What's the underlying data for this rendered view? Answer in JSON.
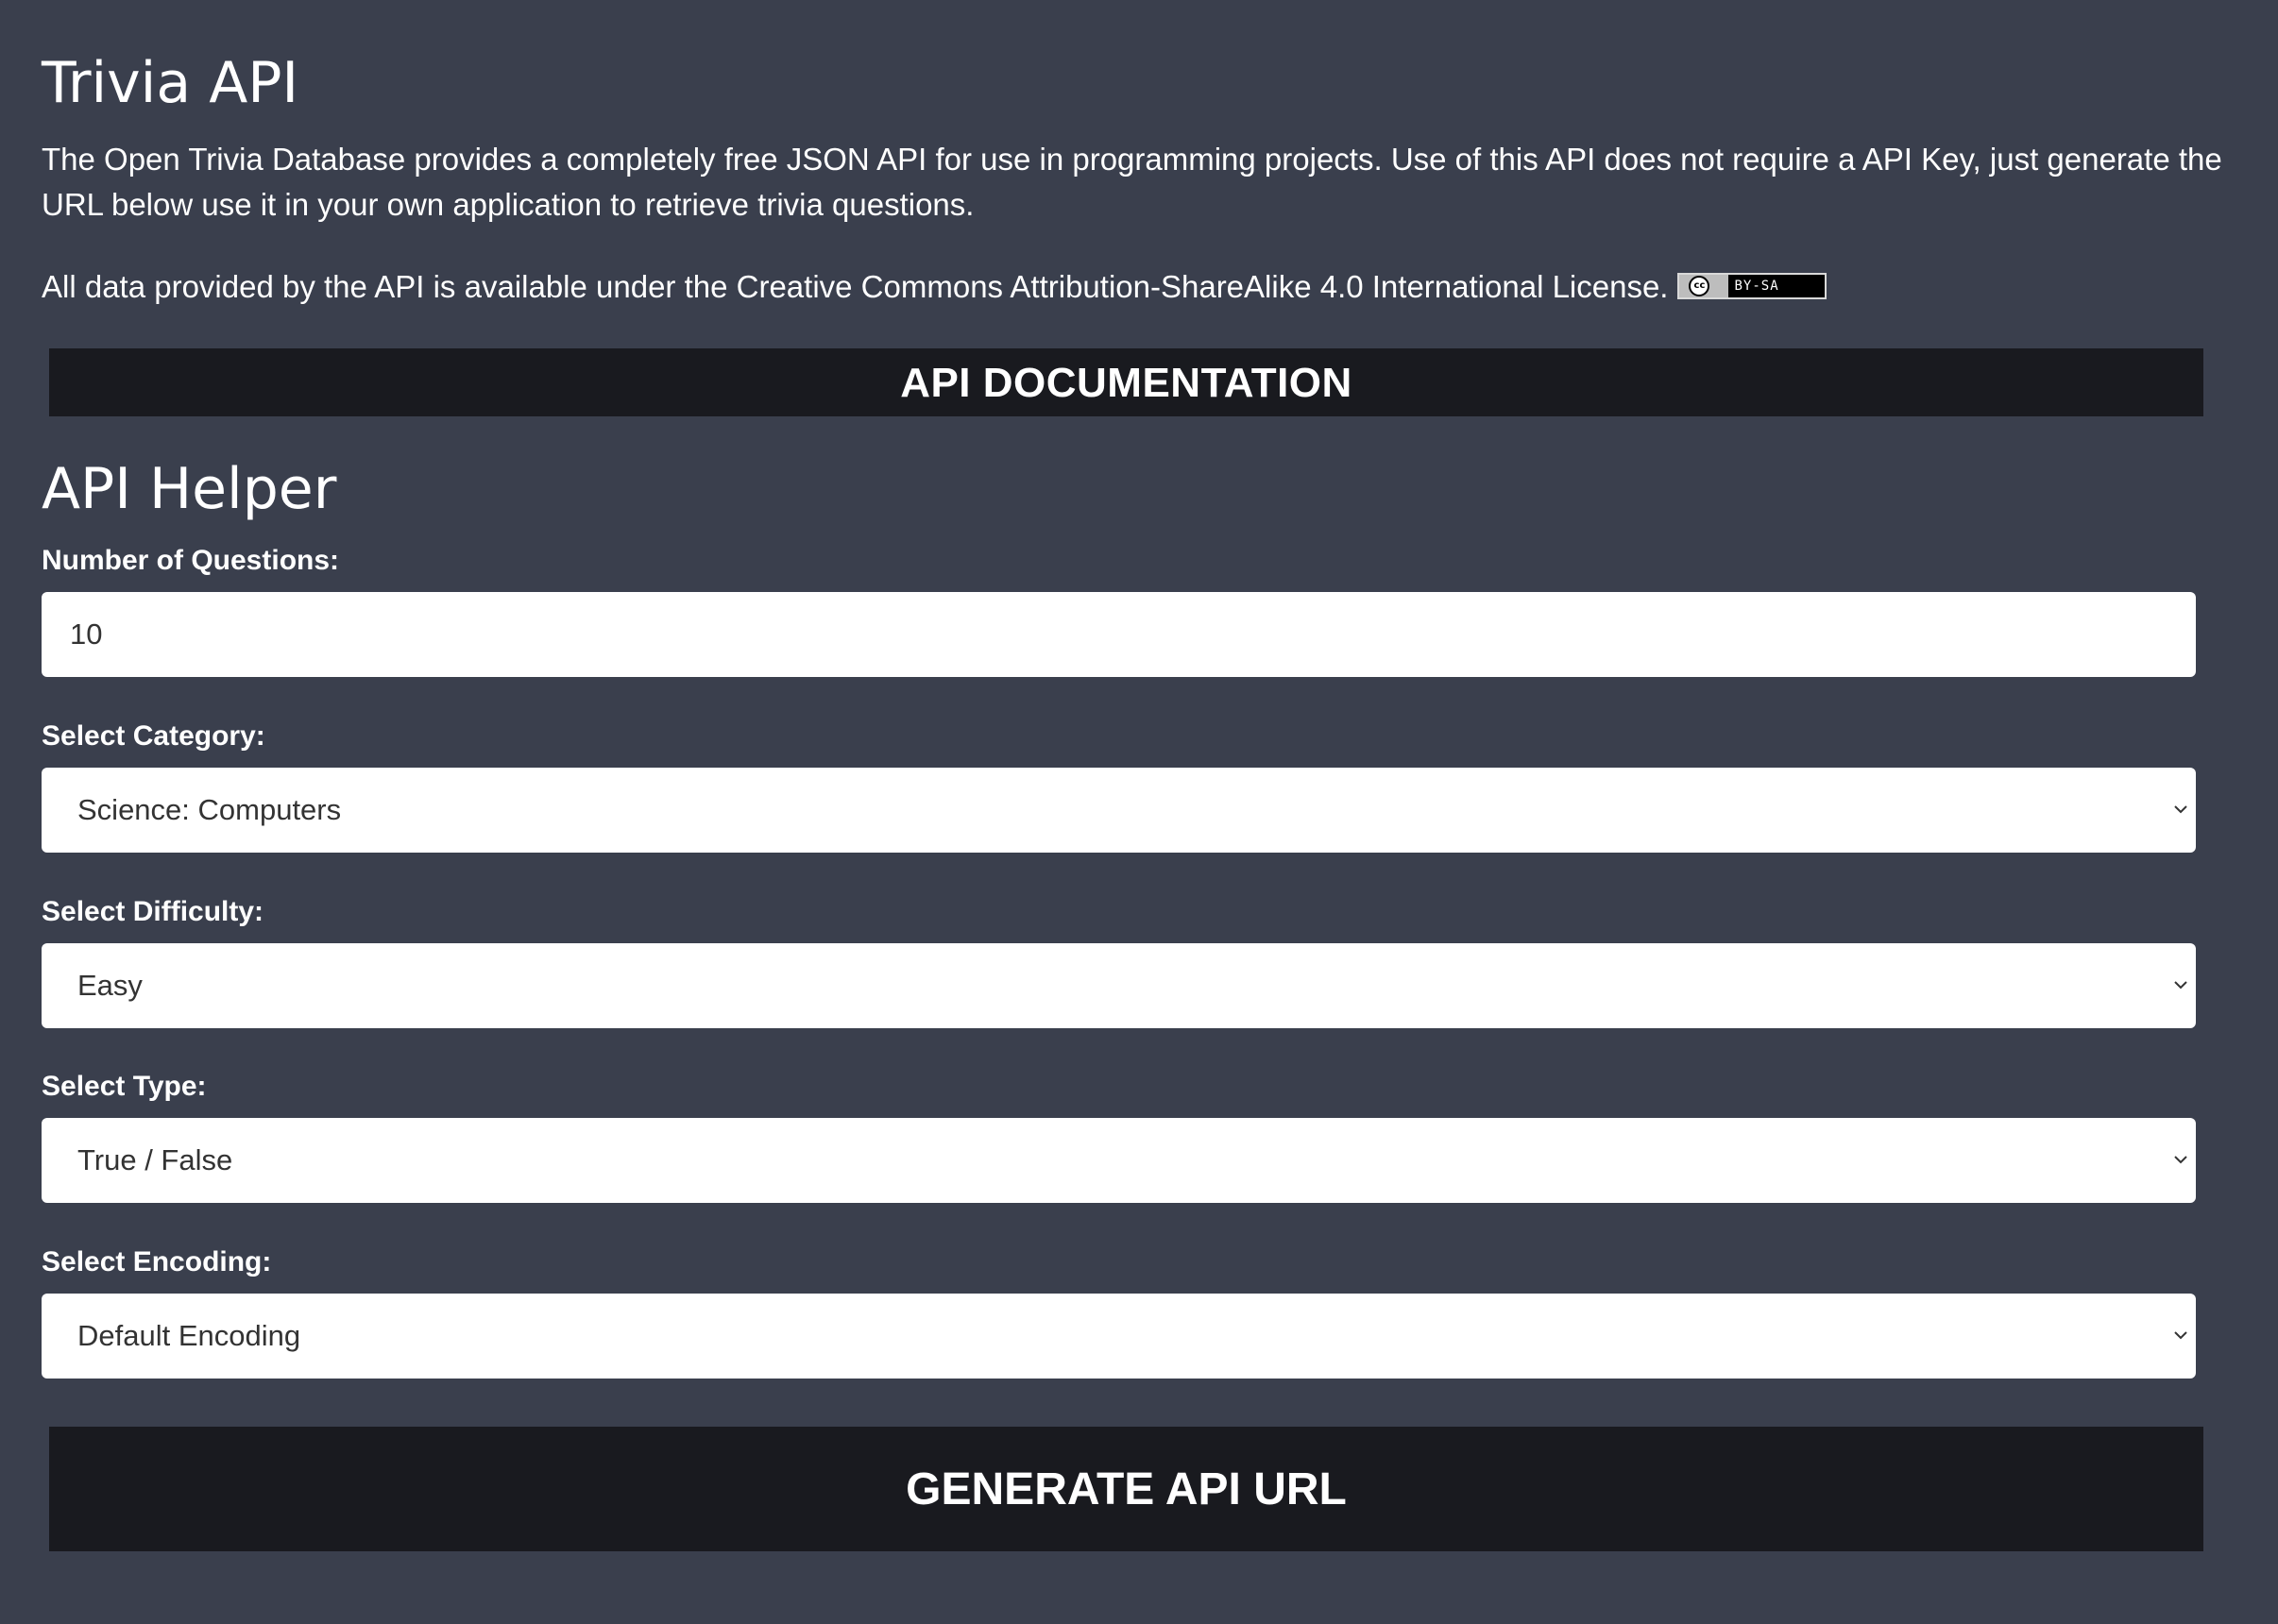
{
  "header": {
    "title": "Trivia API",
    "intro": "The Open Trivia Database provides a completely free JSON API for use in programming projects. Use of this API does not require a API Key, just generate the URL below use it in your own application to retrieve trivia questions.",
    "license_text": "All data provided by the API is available under the Creative Commons Attribution-ShareAlike 4.0 International License.",
    "license_badge": {
      "symbol": "cc",
      "label": "BY-SA"
    }
  },
  "documentation_button": {
    "label": "API DOCUMENTATION"
  },
  "helper": {
    "title": "API Helper",
    "fields": {
      "questions": {
        "label": "Number of Questions:",
        "value": "10"
      },
      "category": {
        "label": "Select Category:",
        "selected": "Science: Computers"
      },
      "difficulty": {
        "label": "Select Difficulty:",
        "selected": "Easy"
      },
      "type": {
        "label": "Select Type:",
        "selected": "True / False"
      },
      "encoding": {
        "label": "Select Encoding:",
        "selected": "Default Encoding"
      }
    },
    "generate_button": {
      "label": "GENERATE API URL"
    }
  },
  "colors": {
    "background": "#3a3f4d",
    "button_background": "#191a1f",
    "field_background": "#ffffff",
    "field_text": "#333333",
    "text": "#ffffff"
  }
}
